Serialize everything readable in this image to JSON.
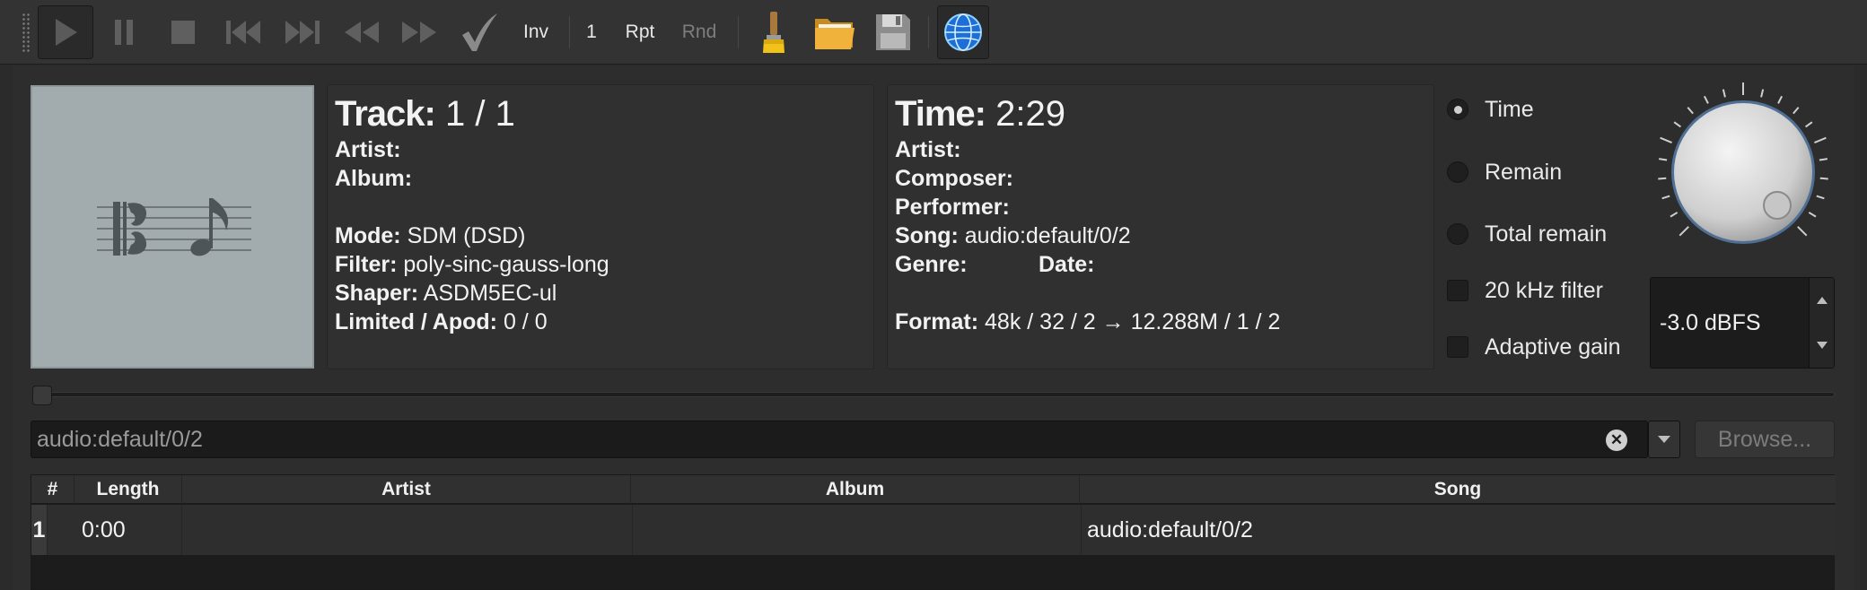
{
  "toolbar": {
    "play": "play-icon",
    "pause": "pause-icon",
    "stop": "stop-icon",
    "prev": "skip-previous-icon",
    "next": "skip-next-icon",
    "rewind": "rewind-icon",
    "forward": "fast-forward-icon",
    "check": "checkmark-icon",
    "inv_label": "Inv",
    "count_label": "1",
    "repeat_label": "Rpt",
    "random_label": "Rnd",
    "clear": "broom-icon",
    "open": "folder-icon",
    "save": "floppy-disk-icon",
    "network": "globe-icon"
  },
  "left_info": {
    "track_label": "Track:",
    "track_value": "1 / 1",
    "artist_label": "Artist:",
    "album_label": "Album:",
    "mode_label": "Mode:",
    "mode_value": "SDM (DSD)",
    "filter_label": "Filter:",
    "filter_value": "poly-sinc-gauss-long",
    "shaper_label": "Shaper:",
    "shaper_value": "ASDM5EC-ul",
    "limited_label": "Limited / Apod:",
    "limited_value": "0 / 0"
  },
  "right_info": {
    "time_label": "Time:",
    "time_value": "2:29",
    "artist_label": "Artist:",
    "composer_label": "Composer:",
    "performer_label": "Performer:",
    "song_label": "Song:",
    "song_value": "audio:default/0/2",
    "genre_label": "Genre:",
    "date_label": "Date:",
    "format_label": "Format:",
    "format_value": "48k / 32 / 2 → 12.288M / 1 / 2"
  },
  "display_mode": {
    "options": [
      "Time",
      "Remain",
      "Total remain"
    ],
    "selected": "Time"
  },
  "toggles": {
    "filter_20k_label": "20 kHz filter",
    "adaptive_gain_label": "Adaptive gain"
  },
  "gain": {
    "value": "-3.0 dBFS"
  },
  "url_bar": {
    "value": "audio:default/0/2",
    "browse_label": "Browse..."
  },
  "playlist": {
    "columns": [
      "#",
      "Length",
      "Artist",
      "Album",
      "Song"
    ],
    "rows": [
      {
        "num": "1",
        "length": "0:00",
        "artist": "",
        "album": "",
        "song": "audio:default/0/2"
      }
    ]
  },
  "colors": {
    "background": "#2b2b2b",
    "panel": "#303030",
    "art_bg": "#a2acaf",
    "text": "#f2f2f2",
    "disabled_text": "#7c7c7c"
  }
}
